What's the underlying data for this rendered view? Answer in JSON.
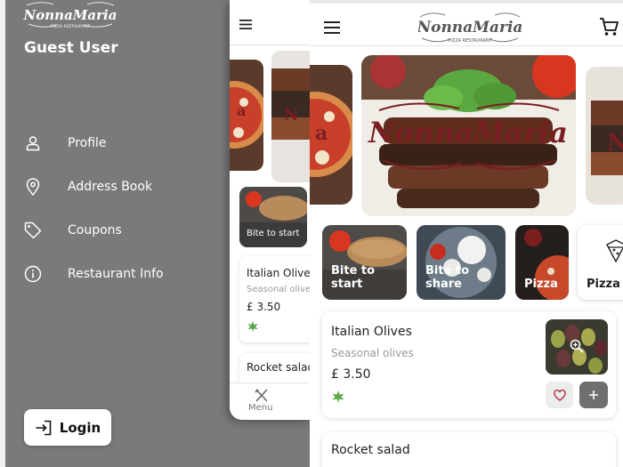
{
  "brand": {
    "name": "NonnaMaria",
    "tagline": "PIZZA RESTAURANT"
  },
  "drawer": {
    "user_name": "Guest User",
    "items": [
      {
        "label": "Profile",
        "icon": "person-icon"
      },
      {
        "label": "Address Book",
        "icon": "location-pin-icon"
      },
      {
        "label": "Coupons",
        "icon": "tag-icon"
      },
      {
        "label": "Restaurant Info",
        "icon": "info-icon"
      }
    ],
    "login_label": "Login"
  },
  "small_view": {
    "category": "Bite to start",
    "item": {
      "name": "Italian  Olives",
      "desc": "Seasonal olives",
      "price": "£ 3.50"
    },
    "item2": {
      "name": "Rocket salad"
    },
    "bottom_nav": {
      "menu_label": "Menu"
    }
  },
  "categories": [
    {
      "label": "Bite to start"
    },
    {
      "label": "Bite to share"
    },
    {
      "label": "Pizza"
    },
    {
      "label": "Pizza S"
    }
  ],
  "items": [
    {
      "name": "Italian  Olives",
      "desc": "Seasonal olives",
      "price": "£ 3.50",
      "veg": true
    },
    {
      "name": "Rocket salad"
    }
  ],
  "colors": {
    "drawer_bg": "#7a7a7c",
    "brand_red": "#7a1e23",
    "add_button": "#6f6f6f"
  }
}
